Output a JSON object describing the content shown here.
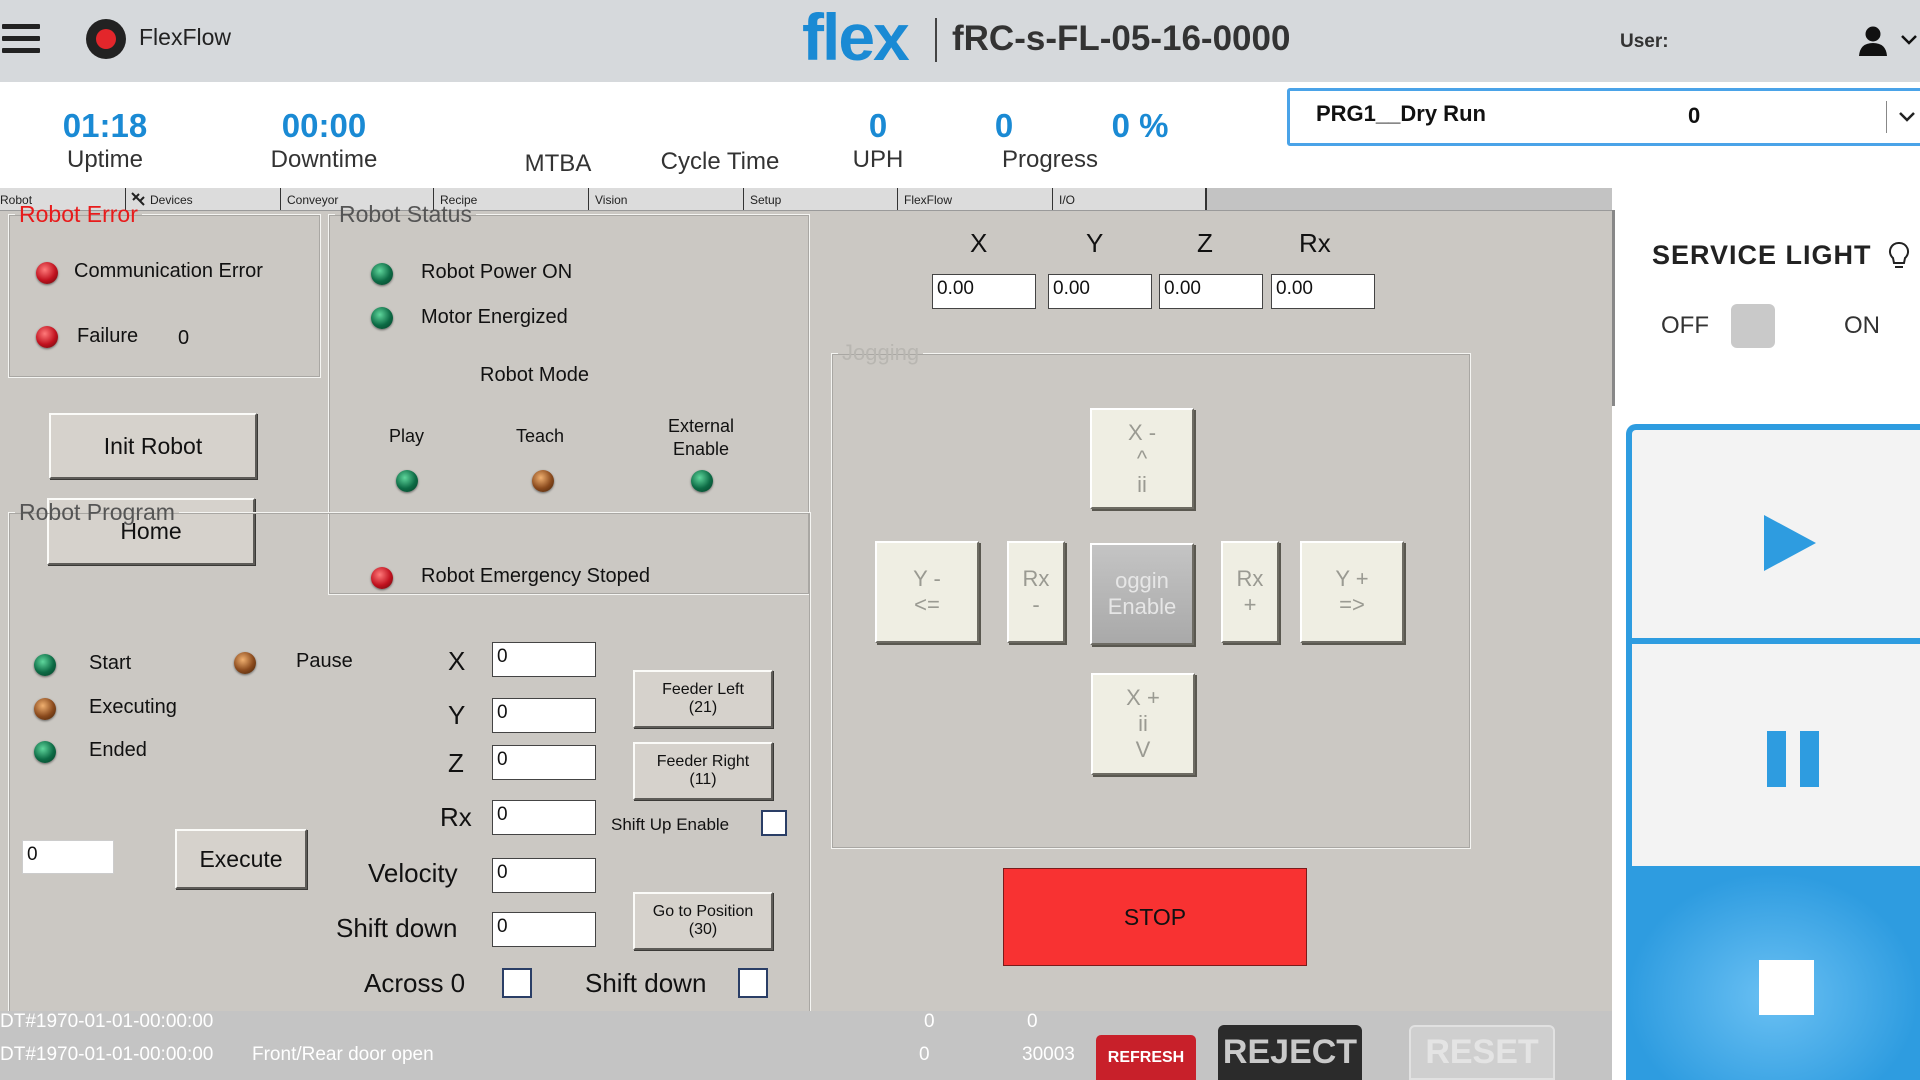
{
  "header": {
    "app_name": "FlexFlow",
    "brand_logo": "flex",
    "device_id": "fRC-s-FL-05-16-0000",
    "user_label": "User:"
  },
  "kpi": {
    "uptime": {
      "value": "01:18",
      "label": "Uptime"
    },
    "downtime": {
      "value": "00:00",
      "label": "Downtime"
    },
    "mtba": {
      "value": "",
      "label": "MTBA"
    },
    "cycle_time": {
      "value": "",
      "label": "Cycle Time"
    },
    "uph": {
      "value": "0",
      "label": "UPH"
    },
    "progress": {
      "value": "0",
      "percent": "0 %",
      "label": "Progress"
    }
  },
  "program_select": {
    "name": "PRG1__Dry Run",
    "count": "0"
  },
  "tabs": [
    "Robot",
    "Devices",
    "Conveyor",
    "Recipe",
    "Vision",
    "Setup",
    "FlexFlow",
    "I/O"
  ],
  "robot_error": {
    "title": "Robot Error",
    "communication_error": "Communication Error",
    "failure": "Failure",
    "failure_count": "0"
  },
  "robot_status": {
    "title": "Robot Status",
    "power_on": "Robot Power ON",
    "motor_energized": "Motor Energized",
    "mode_title": "Robot Mode",
    "mode_play": "Play",
    "mode_teach": "Teach",
    "mode_external_1": "External",
    "mode_external_2": "Enable",
    "emergency": "Robot Emergency Stoped"
  },
  "buttons": {
    "init_robot": "Init Robot",
    "home": "Home",
    "execute": "Execute",
    "feeder_left_1": "Feeder Left",
    "feeder_left_2": "(21)",
    "feeder_right_1": "Feeder Right",
    "feeder_right_2": "(11)",
    "goto_position_1": "Go to Position",
    "goto_position_2": "(30)",
    "stop": "STOP"
  },
  "position": {
    "labels": [
      "X",
      "Y",
      "Z",
      "Rx"
    ],
    "values": [
      "0.00",
      "0.00",
      "0.00",
      "0.00"
    ]
  },
  "jogging": {
    "title": "Jogging",
    "x_minus": [
      "X -",
      "^",
      "ii"
    ],
    "x_plus": [
      "X +",
      "ii",
      "V"
    ],
    "y_minus": [
      "Y -",
      "<="
    ],
    "y_plus": [
      "Y +",
      "=>"
    ],
    "rx_minus": [
      "Rx",
      "-"
    ],
    "rx_plus": [
      "Rx",
      "+"
    ],
    "enable": [
      "oggin",
      "Enable"
    ]
  },
  "robot_program": {
    "title": "Robot Program",
    "start": "Start",
    "pause": "Pause",
    "executing": "Executing",
    "ended": "Ended",
    "program_number": "0",
    "fields": {
      "x": {
        "label": "X",
        "value": "0"
      },
      "y": {
        "label": "Y",
        "value": "0"
      },
      "z": {
        "label": "Z",
        "value": "0"
      },
      "rx": {
        "label": "Rx",
        "value": "0"
      },
      "velocity": {
        "label": "Velocity",
        "value": "0"
      },
      "shift_down": {
        "label": "Shift down",
        "value": "0"
      }
    },
    "shift_up_enable": "Shift  Up Enable",
    "across_0": "Across 0",
    "shift_down_check": "Shift down"
  },
  "status_bar": {
    "row1": {
      "time": "DT#1970-01-01-00:00:00",
      "c1": "0",
      "c2": "0"
    },
    "row2": {
      "time": "DT#1970-01-01-00:00:00",
      "msg": "Front/Rear  door open",
      "c1": "0",
      "c2": "30003"
    },
    "refresh": "REFRESH",
    "reject": "REJECT",
    "reset": "RESET"
  },
  "service_light": {
    "title": "SERVICE LIGHT",
    "off": "OFF",
    "on": "ON"
  },
  "colors": {
    "accent_blue": "#1a8ad4",
    "control_blue": "#2e9ce0",
    "stop_red": "#f83232",
    "refresh_red": "#c8202a"
  }
}
